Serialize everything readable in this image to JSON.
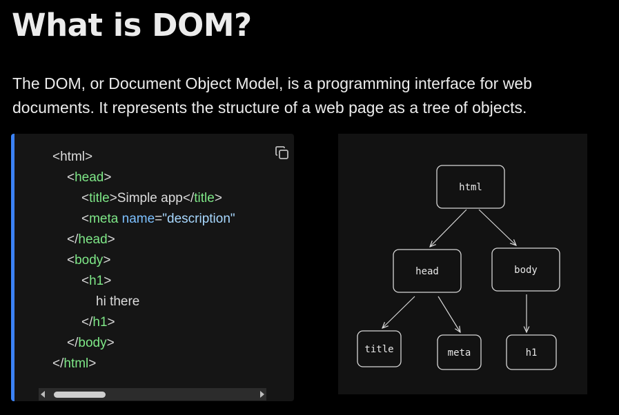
{
  "page": {
    "title": "What is DOM?",
    "intro": "The DOM, or Document Object Model, is a programming interface for web documents. It represents the structure of a web page as a tree of objects."
  },
  "code": {
    "lines": [
      {
        "indent": 0,
        "tokens": [
          {
            "t": "p",
            "v": "<"
          },
          {
            "t": "x",
            "v": "html"
          },
          {
            "t": "p",
            "v": ">"
          }
        ]
      },
      {
        "indent": 1,
        "tokens": [
          {
            "t": "p",
            "v": "<"
          },
          {
            "t": "t",
            "v": "head"
          },
          {
            "t": "p",
            "v": ">"
          }
        ]
      },
      {
        "indent": 2,
        "tokens": [
          {
            "t": "p",
            "v": "<"
          },
          {
            "t": "t",
            "v": "title"
          },
          {
            "t": "p",
            "v": ">"
          },
          {
            "t": "x",
            "v": "Simple app"
          },
          {
            "t": "p",
            "v": "</"
          },
          {
            "t": "t",
            "v": "title"
          },
          {
            "t": "p",
            "v": ">"
          }
        ]
      },
      {
        "indent": 2,
        "tokens": [
          {
            "t": "p",
            "v": "<"
          },
          {
            "t": "t",
            "v": "meta"
          },
          {
            "t": "p",
            "v": " "
          },
          {
            "t": "a",
            "v": "name"
          },
          {
            "t": "p",
            "v": "="
          },
          {
            "t": "s",
            "v": "\"description\""
          }
        ]
      },
      {
        "indent": 1,
        "tokens": [
          {
            "t": "p",
            "v": "</"
          },
          {
            "t": "t",
            "v": "head"
          },
          {
            "t": "p",
            "v": ">"
          }
        ]
      },
      {
        "indent": 1,
        "tokens": [
          {
            "t": "p",
            "v": "<"
          },
          {
            "t": "t",
            "v": "body"
          },
          {
            "t": "p",
            "v": ">"
          }
        ]
      },
      {
        "indent": 2,
        "tokens": [
          {
            "t": "p",
            "v": "<"
          },
          {
            "t": "t",
            "v": "h1"
          },
          {
            "t": "p",
            "v": ">"
          }
        ]
      },
      {
        "indent": 3,
        "tokens": [
          {
            "t": "x",
            "v": "hi there"
          }
        ]
      },
      {
        "indent": 2,
        "tokens": [
          {
            "t": "p",
            "v": "</"
          },
          {
            "t": "t",
            "v": "h1"
          },
          {
            "t": "p",
            "v": ">"
          }
        ]
      },
      {
        "indent": 1,
        "tokens": [
          {
            "t": "p",
            "v": "</"
          },
          {
            "t": "t",
            "v": "body"
          },
          {
            "t": "p",
            "v": ">"
          }
        ]
      },
      {
        "indent": 0,
        "tokens": [
          {
            "t": "p",
            "v": "</"
          },
          {
            "t": "t",
            "v": "html"
          },
          {
            "t": "p",
            "v": ">"
          }
        ]
      }
    ],
    "copy_icon": "copy-icon",
    "accent_color": "#3b82f6",
    "tag_color": "#7ee787",
    "attr_color": "#7cc0ff"
  },
  "diagram": {
    "nodes": [
      {
        "id": "html",
        "label": "html"
      },
      {
        "id": "head",
        "label": "head"
      },
      {
        "id": "body",
        "label": "body"
      },
      {
        "id": "title",
        "label": "title"
      },
      {
        "id": "meta",
        "label": "meta"
      },
      {
        "id": "h1",
        "label": "h1"
      }
    ],
    "edges": [
      [
        "html",
        "head"
      ],
      [
        "html",
        "body"
      ],
      [
        "head",
        "title"
      ],
      [
        "head",
        "meta"
      ],
      [
        "body",
        "h1"
      ]
    ]
  }
}
